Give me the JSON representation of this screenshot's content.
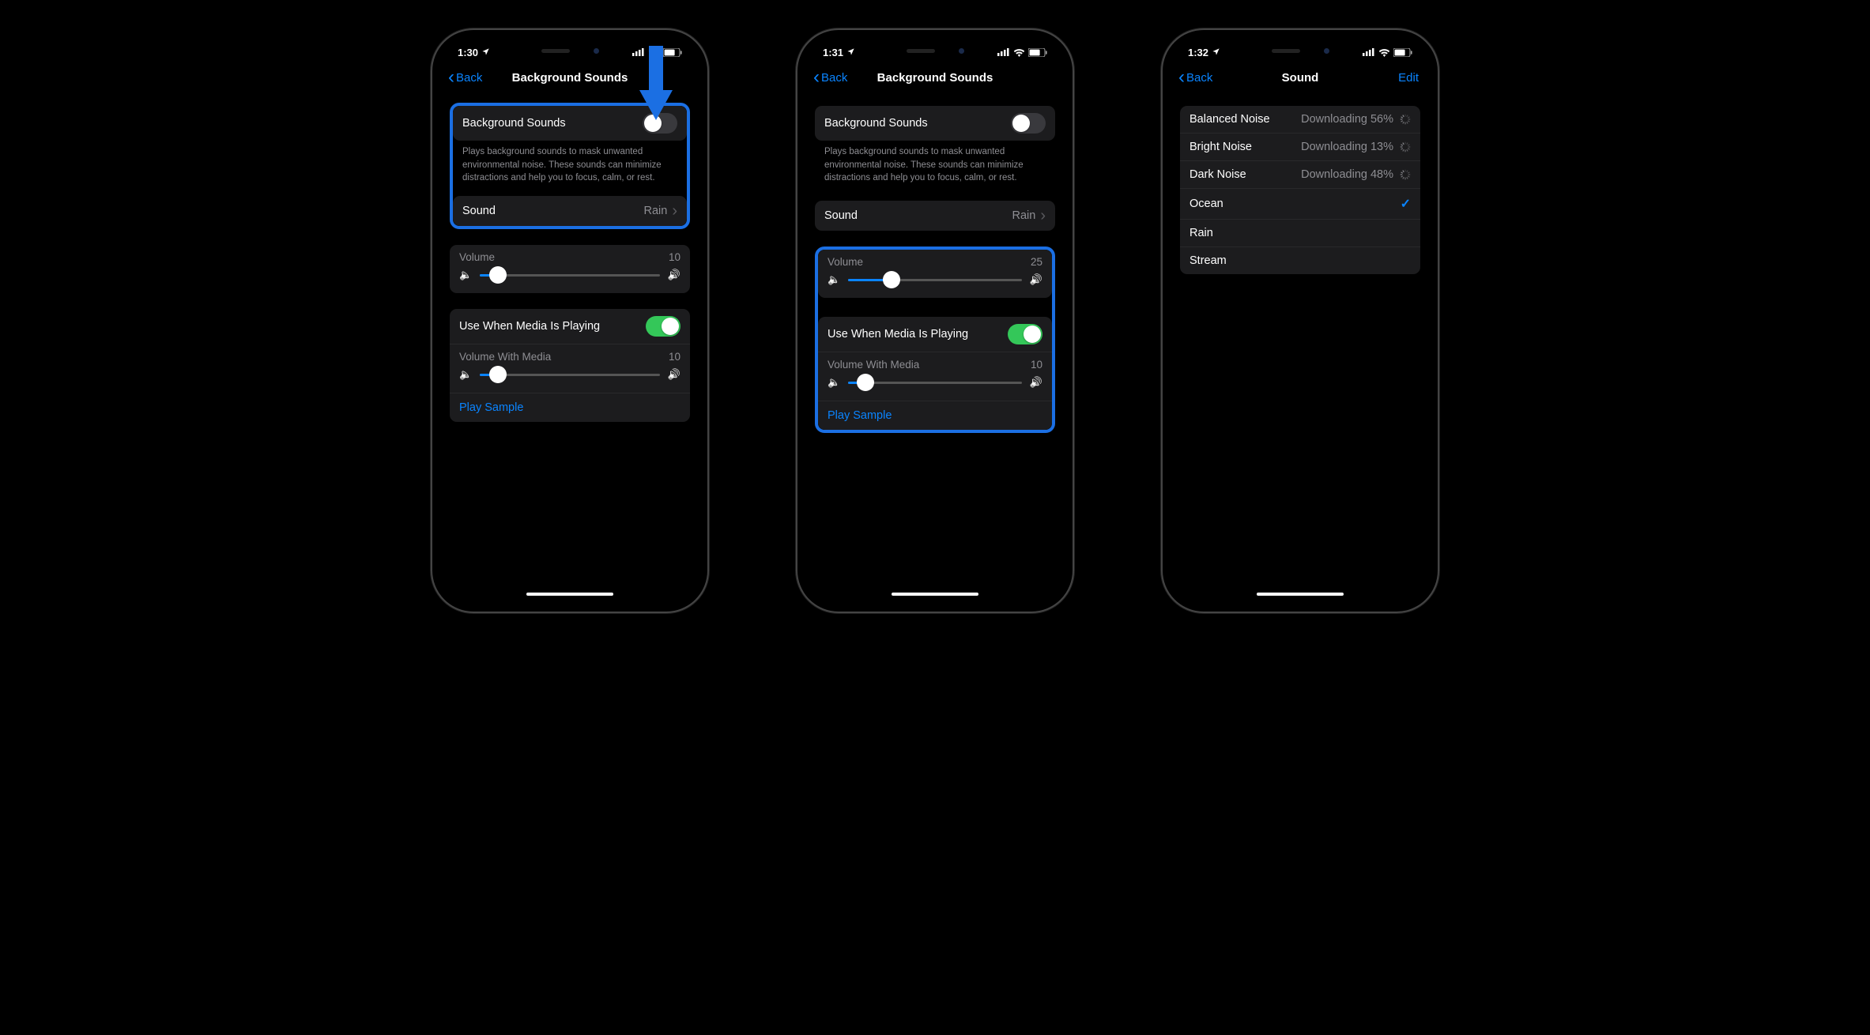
{
  "colors": {
    "blue": "#0a84ff",
    "highlight": "#1b6fe3",
    "green": "#34c759"
  },
  "p1": {
    "time": "1:30",
    "back": "Back",
    "title": "Background Sounds",
    "bg_label": "Background Sounds",
    "bg_on": false,
    "desc": "Plays background sounds to mask unwanted environmental noise. These sounds can minimize distractions and help you to focus, calm, or rest.",
    "sound_label": "Sound",
    "sound_value": "Rain",
    "vol_label": "Volume",
    "vol_value": "10",
    "vol_pct": 10,
    "media_label": "Use When Media Is Playing",
    "media_on": true,
    "vm_label": "Volume With Media",
    "vm_value": "10",
    "vm_pct": 10,
    "play": "Play Sample"
  },
  "p2": {
    "time": "1:31",
    "back": "Back",
    "title": "Background Sounds",
    "bg_label": "Background Sounds",
    "bg_on": false,
    "desc": "Plays background sounds to mask unwanted environmental noise. These sounds can minimize distractions and help you to focus, calm, or rest.",
    "sound_label": "Sound",
    "sound_value": "Rain",
    "vol_label": "Volume",
    "vol_value": "25",
    "vol_pct": 25,
    "media_label": "Use When Media Is Playing",
    "media_on": true,
    "vm_label": "Volume With Media",
    "vm_value": "10",
    "vm_pct": 10,
    "play": "Play Sample"
  },
  "p3": {
    "time": "1:32",
    "back": "Back",
    "title": "Sound",
    "edit": "Edit",
    "sounds": [
      {
        "name": "Balanced Noise",
        "status_label": "Downloading 56%",
        "downloading": true,
        "selected": false
      },
      {
        "name": "Bright Noise",
        "status_label": "Downloading 13%",
        "downloading": true,
        "selected": false
      },
      {
        "name": "Dark Noise",
        "status_label": "Downloading 48%",
        "downloading": true,
        "selected": false
      },
      {
        "name": "Ocean",
        "status_label": "",
        "downloading": false,
        "selected": true
      },
      {
        "name": "Rain",
        "status_label": "",
        "downloading": false,
        "selected": false
      },
      {
        "name": "Stream",
        "status_label": "",
        "downloading": false,
        "selected": false
      }
    ]
  }
}
